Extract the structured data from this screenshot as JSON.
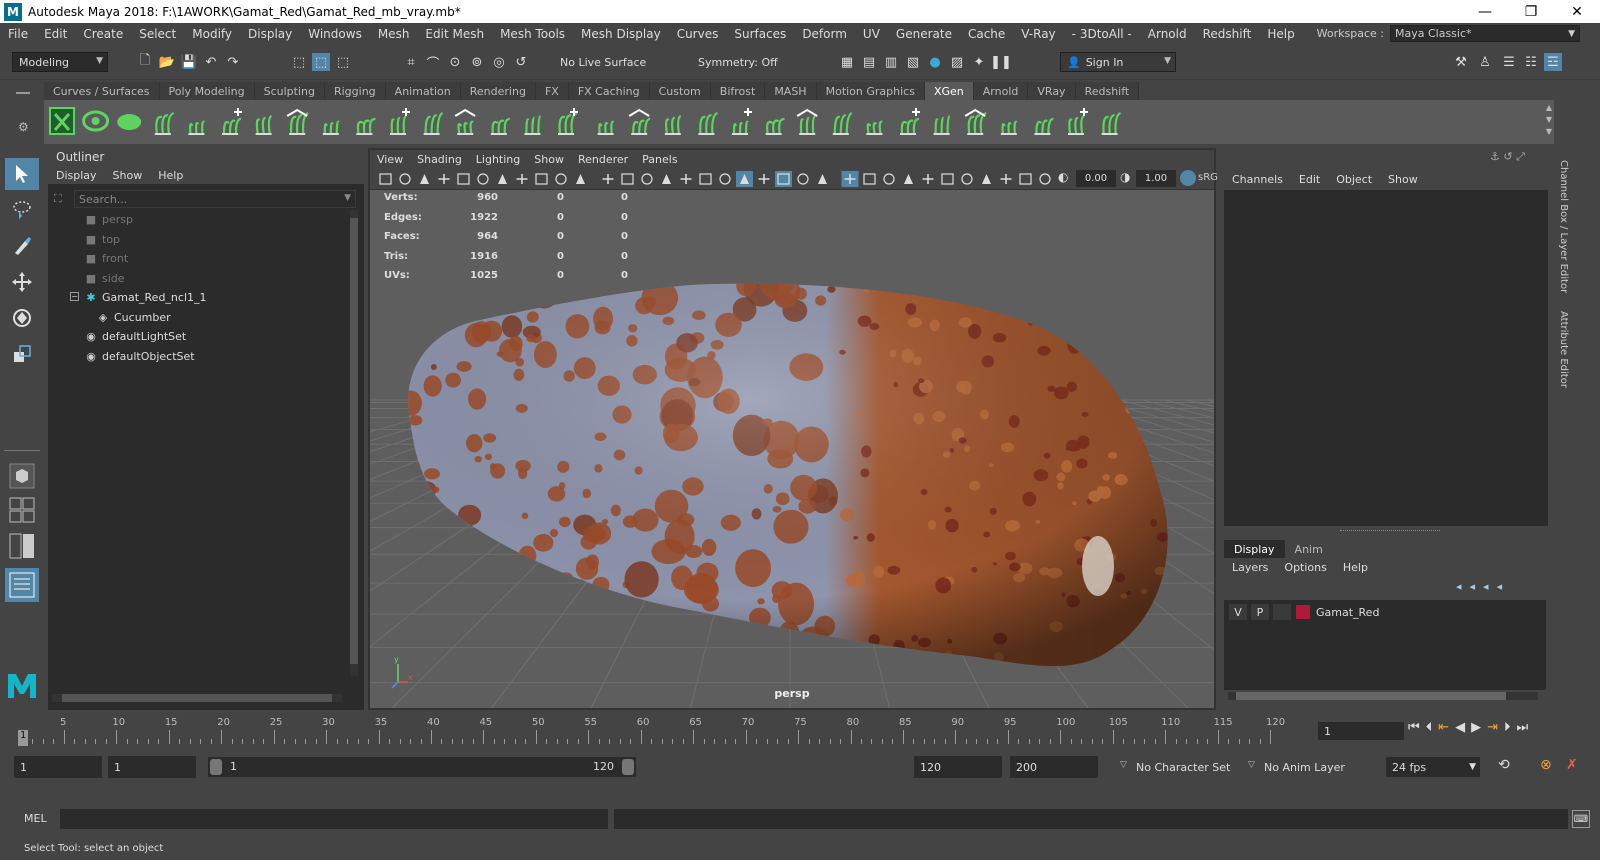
{
  "window": {
    "title": "Autodesk Maya 2018: F:\\1AWORK\\Gamat_Red\\Gamat_Red_mb_vray.mb*",
    "logo": "M",
    "minimize": "—",
    "restore": "❐",
    "close": "✕"
  },
  "menubar": {
    "items": [
      "File",
      "Edit",
      "Create",
      "Select",
      "Modify",
      "Display",
      "Windows",
      "Mesh",
      "Edit Mesh",
      "Mesh Tools",
      "Mesh Display",
      "Curves",
      "Surfaces",
      "Deform",
      "UV",
      "Generate",
      "Cache",
      "V-Ray",
      "- 3DtoAll -",
      "Arnold",
      "Redshift",
      "Help"
    ],
    "workspace_label": "Workspace :",
    "workspace_value": "Maya Classic*"
  },
  "statusline": {
    "mode": "Modeling",
    "live_surface": "No Live Surface",
    "symmetry": "Symmetry: Off",
    "sign_in": "Sign In"
  },
  "shelf": {
    "tabs": [
      "Curves / Surfaces",
      "Poly Modeling",
      "Sculpting",
      "Rigging",
      "Animation",
      "Rendering",
      "FX",
      "FX Caching",
      "Custom",
      "Bifrost",
      "MASH",
      "Motion Graphics",
      "XGen",
      "Arnold",
      "VRay",
      "Redshift"
    ],
    "active_tab": "XGen",
    "icon_color": "#5fd35f"
  },
  "outliner": {
    "title": "Outliner",
    "menu": [
      "Display",
      "Show",
      "Help"
    ],
    "search_placeholder": "Search...",
    "items": [
      {
        "label": "persp",
        "indent": 1,
        "dim": true,
        "icon": "camera-icon"
      },
      {
        "label": "top",
        "indent": 1,
        "dim": true,
        "icon": "camera-icon"
      },
      {
        "label": "front",
        "indent": 1,
        "dim": true,
        "icon": "camera-icon"
      },
      {
        "label": "side",
        "indent": 1,
        "dim": true,
        "icon": "camera-icon"
      },
      {
        "label": "Gamat_Red_ncl1_1",
        "indent": 1,
        "dim": false,
        "icon": "group-icon"
      },
      {
        "label": "Cucumber",
        "indent": 2,
        "dim": false,
        "icon": "mesh-icon"
      },
      {
        "label": "defaultLightSet",
        "indent": 1,
        "dim": false,
        "icon": "set-icon"
      },
      {
        "label": "defaultObjectSet",
        "indent": 1,
        "dim": false,
        "icon": "set-icon"
      }
    ]
  },
  "viewport": {
    "menu": [
      "View",
      "Shading",
      "Lighting",
      "Show",
      "Renderer",
      "Panels"
    ],
    "exposure": "0.00",
    "gamma": "1.00",
    "colorspace": "sRG",
    "hud": [
      {
        "label": "Verts:",
        "a": "960",
        "b": "0",
        "c": "0"
      },
      {
        "label": "Edges:",
        "a": "1922",
        "b": "0",
        "c": "0"
      },
      {
        "label": "Faces:",
        "a": "964",
        "b": "0",
        "c": "0"
      },
      {
        "label": "Tris:",
        "a": "1916",
        "b": "0",
        "c": "0"
      },
      {
        "label": "UVs:",
        "a": "1025",
        "b": "0",
        "c": "0"
      }
    ],
    "camera": "persp"
  },
  "channelbox": {
    "menu": [
      "Channels",
      "Edit",
      "Object",
      "Show"
    ],
    "side_tabs": [
      "Channel Box / Layer Editor",
      "Attribute Editor"
    ]
  },
  "layers": {
    "tabs": [
      "Display",
      "Anim"
    ],
    "menu": [
      "Layers",
      "Options",
      "Help"
    ],
    "row": {
      "v": "V",
      "p": "P",
      "name": "Gamat_Red",
      "color": "#b0193a"
    }
  },
  "timeline": {
    "labels": [
      "5",
      "10",
      "15",
      "20",
      "25",
      "30",
      "35",
      "40",
      "45",
      "50",
      "55",
      "60",
      "65",
      "70",
      "75",
      "80",
      "85",
      "90",
      "95",
      "100",
      "105",
      "110",
      "115",
      "120"
    ],
    "start_label": "1",
    "current_frame": "1"
  },
  "range": {
    "start": "1",
    "start2": "1",
    "slider_start": "1",
    "slider_end": "120",
    "end": "120",
    "end2": "200",
    "character_set": "No Character Set",
    "anim_layer": "No Anim Layer",
    "fps": "24 fps"
  },
  "cmd": {
    "lang": "MEL"
  },
  "help": {
    "text": "Select Tool: select an object"
  }
}
